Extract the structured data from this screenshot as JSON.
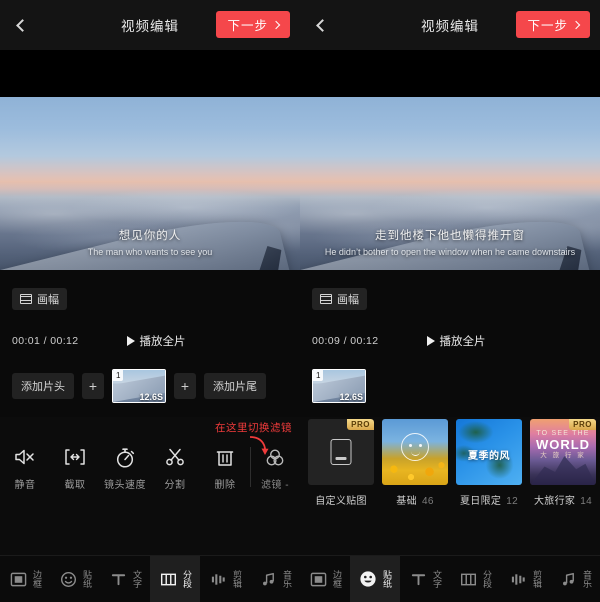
{
  "panels": [
    {
      "header": {
        "title": "视频编辑",
        "next_label": "下一步",
        "back_icon": "chevron-left-icon"
      },
      "preview": {
        "subtitle_cn": "想见你的人",
        "subtitle_en": "The man who wants to see you"
      },
      "aspect": {
        "label": "画幅",
        "icon": "aspect-ratio-icon"
      },
      "timeline": {
        "time_code": "00:01 / 00:12",
        "play_all_label": "播放全片"
      },
      "clip_strip": {
        "add_intro_label": "添加片头",
        "add_outro_label": "添加片尾",
        "plus_label": "+",
        "clip": {
          "index": "1",
          "duration": "12.6S"
        }
      },
      "tools": {
        "annotation": "在这里切换滤镜",
        "items": [
          {
            "label": "静音",
            "icon": "mute-icon"
          },
          {
            "label": "截取",
            "icon": "crop-icon"
          },
          {
            "label": "镜头速度",
            "icon": "speed-icon"
          },
          {
            "label": "分割",
            "icon": "split-icon"
          },
          {
            "label": "删除",
            "icon": "trash-icon"
          },
          {
            "label": "滤镜 -",
            "icon": "filter-icon"
          }
        ]
      },
      "bottom_nav": {
        "active_index": 3,
        "items": [
          {
            "label": "边框",
            "icon": "frame-icon"
          },
          {
            "label": "贴纸",
            "icon": "sticker-icon"
          },
          {
            "label": "文字",
            "icon": "text-icon"
          },
          {
            "label": "分段",
            "icon": "segment-icon"
          },
          {
            "label": "剪辑",
            "icon": "clip-icon"
          },
          {
            "label": "音乐",
            "icon": "music-icon"
          }
        ]
      }
    },
    {
      "header": {
        "title": "视频编辑",
        "next_label": "下一步",
        "back_icon": "chevron-left-icon"
      },
      "preview": {
        "subtitle_cn": "走到他楼下他也懒得推开窗",
        "subtitle_en": "He didn’t bother to open the window when he came downstairs"
      },
      "aspect": {
        "label": "画幅",
        "icon": "aspect-ratio-icon"
      },
      "timeline": {
        "time_code": "00:09 / 00:12",
        "play_all_label": "播放全片"
      },
      "clip_strip": {
        "clip": {
          "index": "1",
          "duration": "12.6S"
        }
      },
      "sticker_cards": [
        {
          "label": "自定义贴图",
          "count": "",
          "pro": "PRO",
          "kind": "custom"
        },
        {
          "label": "基础",
          "count": "46",
          "pro": "",
          "kind": "flowers"
        },
        {
          "label": "夏日限定",
          "count": "12",
          "pro": "",
          "kind": "palm",
          "overlay_text": "夏季的风"
        },
        {
          "label": "大旅行家",
          "count": "14",
          "pro": "PRO",
          "kind": "mountain",
          "overlay_line1": "TO SEE THE",
          "overlay_line2": "WORLD",
          "overlay_line3": "大 旅 行 家"
        }
      ],
      "bottom_nav": {
        "active_index": 1,
        "items": [
          {
            "label": "边框",
            "icon": "frame-icon"
          },
          {
            "label": "贴纸",
            "icon": "sticker-icon"
          },
          {
            "label": "文字",
            "icon": "text-icon"
          },
          {
            "label": "分段",
            "icon": "segment-icon"
          },
          {
            "label": "剪辑",
            "icon": "clip-icon"
          },
          {
            "label": "音乐",
            "icon": "music-icon"
          }
        ]
      }
    }
  ],
  "colors": {
    "accent_red": "#f5474b",
    "annotation_red": "#f03b3b",
    "pro_gold": "#d9a84b",
    "background": "#0a0a0a"
  }
}
